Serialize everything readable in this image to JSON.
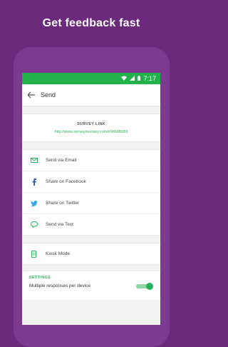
{
  "promo": {
    "headline": "Get feedback fast"
  },
  "statusbar": {
    "time": "7:17"
  },
  "appbar": {
    "title": "Send"
  },
  "survey_link": {
    "label": "SURVEY LINK",
    "url": "http://www.surveymonkey.com/r/9KMB083"
  },
  "share_items": [
    {
      "label": "Send via Email",
      "icon": "email-icon"
    },
    {
      "label": "Share on Facebook",
      "icon": "facebook-icon"
    },
    {
      "label": "Share on Twitter",
      "icon": "twitter-icon"
    },
    {
      "label": "Send via Text",
      "icon": "chat-bubble-icon"
    }
  ],
  "kiosk": {
    "label": "Kiosk Mode",
    "icon": "tablet-icon"
  },
  "settings": {
    "header": "SETTINGS",
    "option_label": "Multiple responses per device",
    "option_enabled": true
  },
  "colors": {
    "brand_purple": "#6b2a7c",
    "status_green": "#22b24c",
    "accent_green": "#2bb45a"
  }
}
